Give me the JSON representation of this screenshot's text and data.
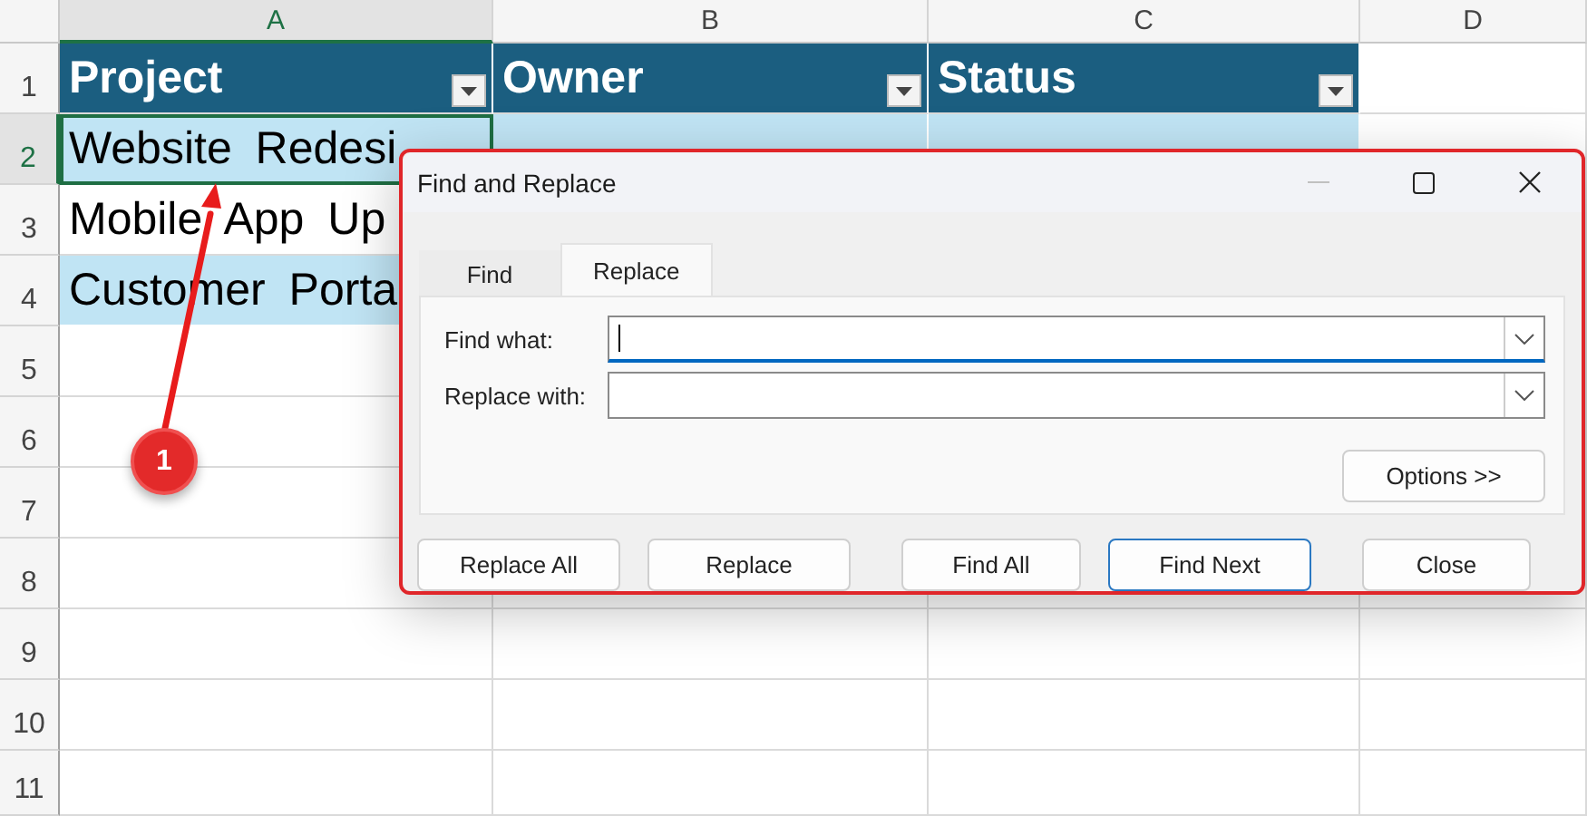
{
  "columns": [
    {
      "label": "A",
      "selected": true
    },
    {
      "label": "B",
      "selected": false
    },
    {
      "label": "C",
      "selected": false
    },
    {
      "label": "D",
      "selected": false
    }
  ],
  "rows": [
    {
      "number": "1",
      "selected": false,
      "kind": "header",
      "cells": [
        {
          "text": "Project",
          "selected": false
        },
        {
          "text": "Owner",
          "selected": false
        },
        {
          "text": "Status",
          "selected": false
        }
      ]
    },
    {
      "number": "2",
      "selected": true,
      "kind": "banded",
      "cells": [
        {
          "text": "Website Redesi",
          "selected": true
        }
      ]
    },
    {
      "number": "3",
      "selected": false,
      "kind": "plain",
      "cells": [
        {
          "text": "Mobile App Up",
          "selected": false
        }
      ]
    },
    {
      "number": "4",
      "selected": false,
      "kind": "banded",
      "cells": [
        {
          "text": "Customer Porta",
          "selected": false
        }
      ]
    },
    {
      "number": "5",
      "selected": false,
      "kind": "empty",
      "cells": []
    },
    {
      "number": "6",
      "selected": false,
      "kind": "empty",
      "cells": []
    },
    {
      "number": "7",
      "selected": false,
      "kind": "empty",
      "cells": []
    },
    {
      "number": "8",
      "selected": false,
      "kind": "empty",
      "cells": []
    },
    {
      "number": "9",
      "selected": false,
      "kind": "empty",
      "cells": []
    },
    {
      "number": "10",
      "selected": false,
      "kind": "empty",
      "cells": []
    },
    {
      "number": "11",
      "selected": false,
      "kind": "empty",
      "cells": []
    }
  ],
  "dialog": {
    "title": "Find and Replace",
    "tabs": [
      {
        "label": "Find",
        "selected": false
      },
      {
        "label": "Replace",
        "selected": true
      }
    ],
    "fields": [
      {
        "label": "Find what:",
        "focused": true
      },
      {
        "label": "Replace with:",
        "focused": false
      }
    ],
    "options_button": "Options >>",
    "buttons": [
      {
        "label": "Replace All",
        "default": false
      },
      {
        "label": "Replace",
        "default": false
      },
      {
        "label": "Find All",
        "default": false
      },
      {
        "label": "Find Next",
        "default": true
      },
      {
        "label": "Close",
        "default": false
      }
    ]
  },
  "callout": {
    "number": "1"
  }
}
